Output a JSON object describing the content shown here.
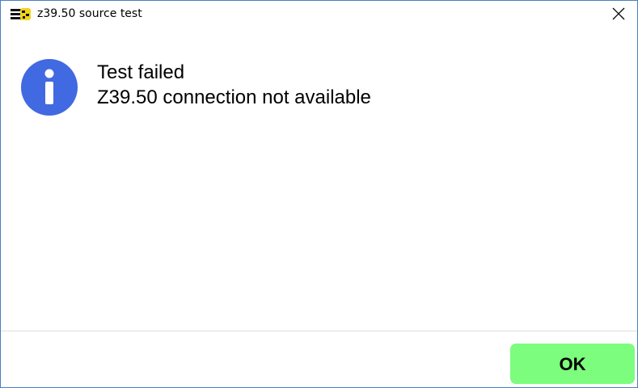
{
  "window": {
    "title": "z39.50 source test",
    "app_icon": "app-icon",
    "close_icon": "close-icon"
  },
  "dialog": {
    "icon": "info-icon",
    "icon_color": "#4169e1",
    "message_line1": "Test failed",
    "message_line2": "Z39.50 connection not available"
  },
  "footer": {
    "ok_label": "OK",
    "ok_color": "#7dfd7d"
  }
}
